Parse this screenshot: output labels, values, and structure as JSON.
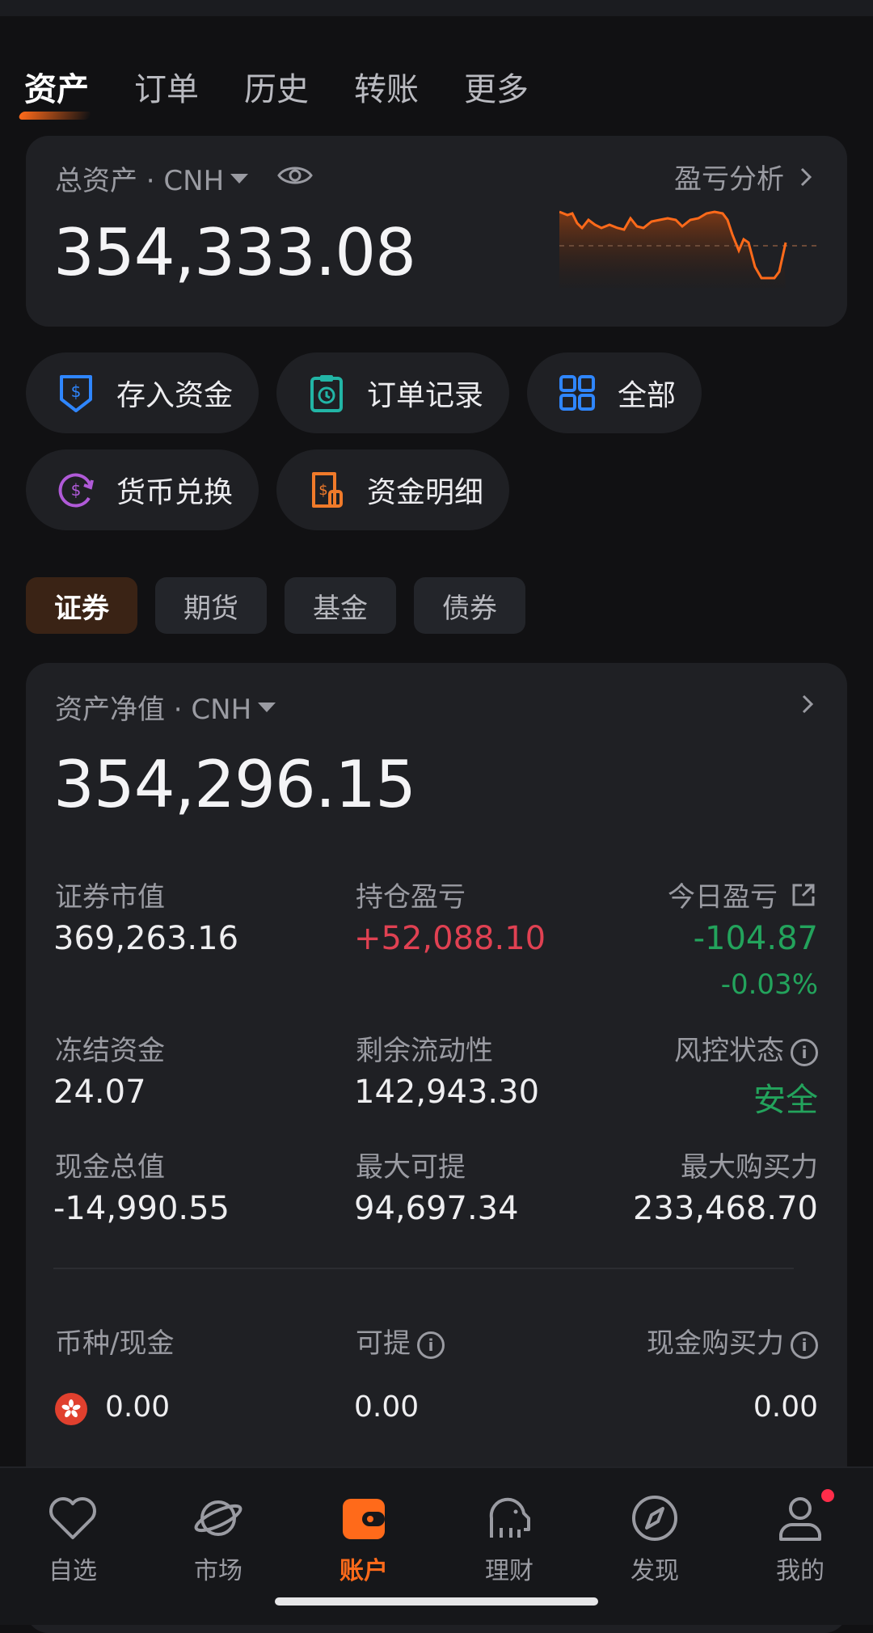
{
  "tabs": [
    {
      "label": "资产",
      "active": true
    },
    {
      "label": "订单",
      "active": false
    },
    {
      "label": "历史",
      "active": false
    },
    {
      "label": "转账",
      "active": false
    },
    {
      "label": "更多",
      "active": false
    }
  ],
  "summary": {
    "label": "总资产 · CNH",
    "analysis": "盈亏分析",
    "total": "354,333.08"
  },
  "quick_actions": [
    {
      "label": "存入资金",
      "icon": "deposit-icon"
    },
    {
      "label": "订单记录",
      "icon": "order-record-icon"
    },
    {
      "label": "全部",
      "icon": "grid-icon"
    },
    {
      "label": "货币兑换",
      "icon": "currency-exchange-icon"
    },
    {
      "label": "资金明细",
      "icon": "fund-detail-icon"
    }
  ],
  "segments": [
    {
      "label": "证券",
      "active": true
    },
    {
      "label": "期货",
      "active": false
    },
    {
      "label": "基金",
      "active": false
    },
    {
      "label": "债券",
      "active": false
    }
  ],
  "detail": {
    "label": "资产净值 · CNH",
    "net_value": "354,296.15",
    "market_value_label": "证券市值",
    "market_value": "369,263.16",
    "position_pl_label": "持仓盈亏",
    "position_pl": "+52,088.10",
    "today_pl_label": "今日盈亏",
    "today_pl": "-104.87",
    "today_pl_pct": "-0.03%",
    "frozen_label": "冻结资金",
    "frozen": "24.07",
    "liquidity_label": "剩余流动性",
    "liquidity": "142,943.30",
    "risk_label": "风控状态",
    "risk": "安全",
    "cash_label": "现金总值",
    "cash": "-14,990.55",
    "max_withdraw_label": "最大可提",
    "max_withdraw": "94,697.34",
    "max_buy_label": "最大购买力",
    "max_buy": "233,468.70",
    "currency_header": "币种/现金",
    "withdrawable_header": "可提",
    "cash_buying_header": "现金购买力",
    "hkd_cash": "0.00",
    "hkd_withdrawable": "0.00",
    "hkd_cash_buying": "0.00"
  },
  "bottom_nav": [
    {
      "label": "自选",
      "icon": "heart-icon"
    },
    {
      "label": "市场",
      "icon": "planet-icon"
    },
    {
      "label": "账户",
      "icon": "wallet-icon",
      "active": true
    },
    {
      "label": "理财",
      "icon": "elephant-icon"
    },
    {
      "label": "发现",
      "icon": "compass-icon"
    },
    {
      "label": "我的",
      "icon": "user-icon"
    }
  ],
  "colors": {
    "accent": "#ff6a1a",
    "negative_green": "#23a35c",
    "positive_red": "#e04152"
  }
}
